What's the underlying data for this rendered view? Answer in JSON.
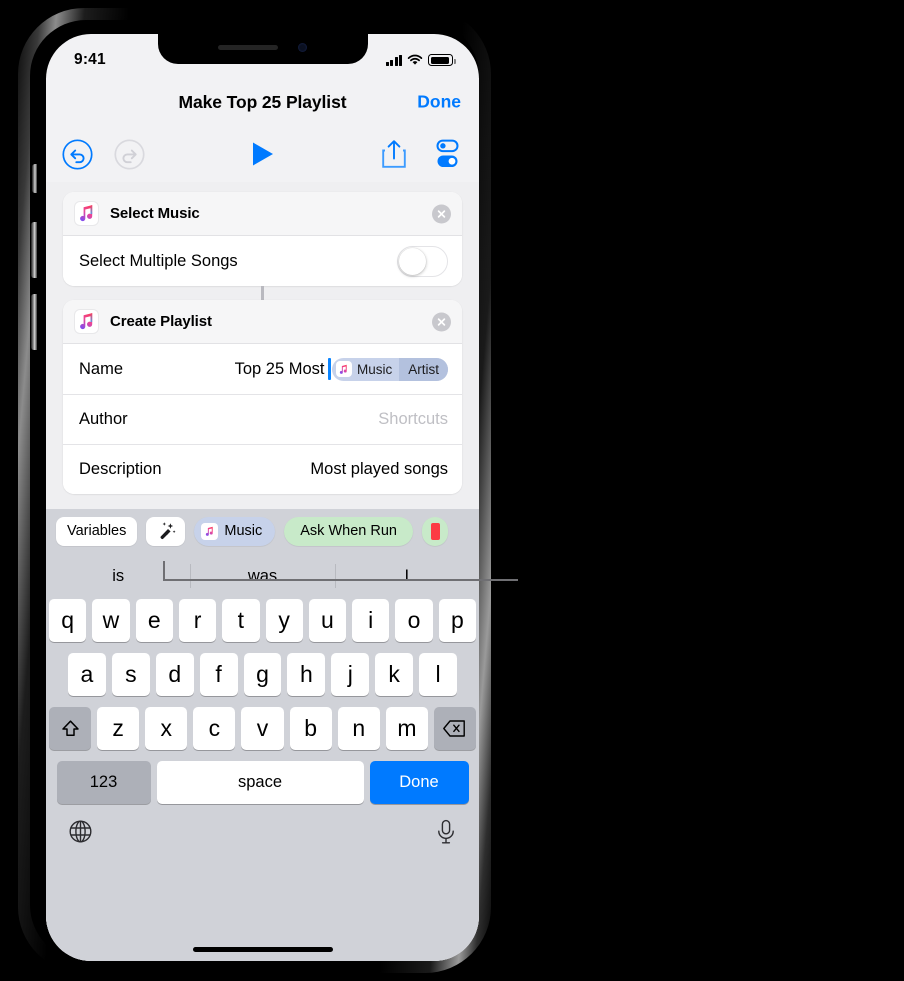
{
  "status_bar": {
    "time": "9:41",
    "cellular_icon": "cellular-signal-icon",
    "wifi_icon": "wifi-icon",
    "battery_icon": "battery-icon"
  },
  "nav_bar": {
    "title": "Make Top 25 Playlist",
    "done_label": "Done"
  },
  "toolbar": {
    "undo_icon": "undo-icon",
    "redo_icon": "redo-icon",
    "play_icon": "play-icon",
    "share_icon": "share-icon",
    "settings_icon": "settings-toggles-icon",
    "accent_color": "#007aff",
    "disabled_color": "#d6d6da"
  },
  "actions": [
    {
      "app_icon": "apple-music-icon",
      "title": "Select Music",
      "close_icon": "close-icon",
      "rows": [
        {
          "label": "Select Multiple Songs",
          "control": "toggle",
          "value": "off"
        }
      ]
    },
    {
      "app_icon": "apple-music-icon",
      "title": "Create Playlist",
      "close_icon": "close-icon",
      "rows": [
        {
          "label": "Name",
          "value": "Top 25 Most",
          "token": {
            "icon": "apple-music-icon",
            "name": "Music",
            "property": "Artist"
          }
        },
        {
          "label": "Author",
          "value": "Shortcuts",
          "placeholder": true
        },
        {
          "label": "Description",
          "value": "Most played songs"
        }
      ]
    }
  ],
  "variables_bar": {
    "variables_label": "Variables",
    "magic_variable_icon": "magic-wand-icon",
    "chips": [
      {
        "label": "Music",
        "icon": "apple-music-icon",
        "color": "#c7d2ea"
      },
      {
        "label": "Ask When Run",
        "color": "#c8eac9"
      }
    ]
  },
  "keyboard": {
    "predictions": [
      "is",
      "was",
      "I"
    ],
    "row1": [
      "q",
      "w",
      "e",
      "r",
      "t",
      "y",
      "u",
      "i",
      "o",
      "p"
    ],
    "row2": [
      "a",
      "s",
      "d",
      "f",
      "g",
      "h",
      "j",
      "k",
      "l"
    ],
    "row3": [
      "z",
      "x",
      "c",
      "v",
      "b",
      "n",
      "m"
    ],
    "shift_icon": "shift-arrow-icon",
    "backspace_icon": "backspace-icon",
    "numbers_label": "123",
    "space_label": "space",
    "done_label": "Done",
    "globe_icon": "globe-icon",
    "dictation_icon": "microphone-icon"
  }
}
